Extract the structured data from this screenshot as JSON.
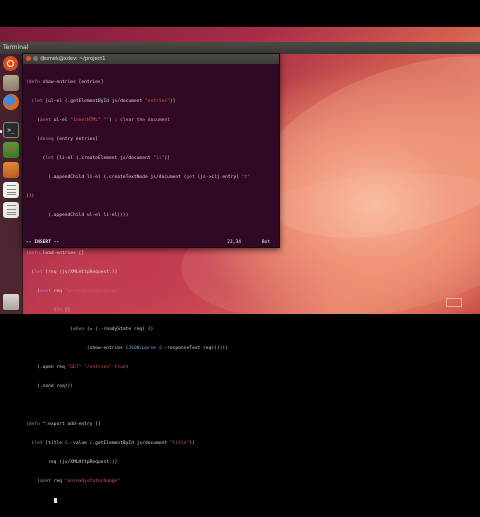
{
  "top_panel": {
    "app_name": "Terminal"
  },
  "launcher": {
    "items": [
      {
        "name": "dash-icon"
      },
      {
        "name": "files-icon"
      },
      {
        "name": "firefox-icon"
      },
      {
        "name": "terminal-icon",
        "glyph": ">_"
      },
      {
        "name": "calc-icon"
      },
      {
        "name": "impress-icon"
      },
      {
        "name": "document-icon"
      },
      {
        "name": "document-icon-2"
      },
      {
        "name": "trash-icon"
      }
    ]
  },
  "terminal": {
    "title": "tomek@xdev: ~/project1",
    "mode": "-- INSERT --",
    "position": "23,34",
    "scroll": "Bot"
  },
  "colors": {
    "terminal_bg": "#300a24",
    "keyword": "#c977d6",
    "string": "#e05a5a",
    "accent": "#d74f1e"
  }
}
